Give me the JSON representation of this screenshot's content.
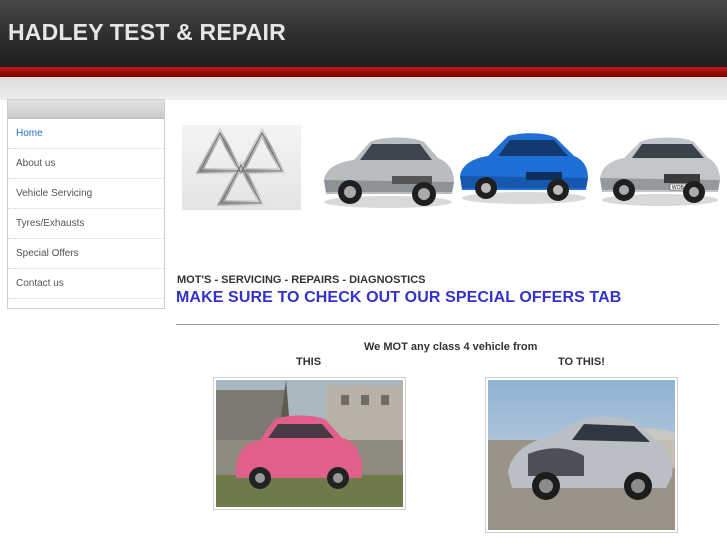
{
  "header": {
    "site_title": "HADLEY TEST & REPAIR"
  },
  "sidebar": {
    "items": [
      {
        "label": "Home",
        "active": true
      },
      {
        "label": "About us",
        "active": false
      },
      {
        "label": "Vehicle Servicing",
        "active": false
      },
      {
        "label": "Tyres/Exhausts",
        "active": false
      },
      {
        "label": "Special Offers",
        "active": false
      },
      {
        "label": "Contact us",
        "active": false
      }
    ]
  },
  "main": {
    "tagline": "MOT'S - SERVICING - REPAIRS - DIAGNOSTICS",
    "offers_heading": "MAKE SURE TO CHECK OUT OUR SPECIAL OFFERS TAB",
    "mot_line": "We MOT any class 4 vehicle from",
    "label_this": "THIS",
    "label_tothis": "TO THIS!"
  },
  "banner": {
    "number_plate": "WOB Y 688"
  },
  "colors": {
    "header_bg": "#2e2e2e",
    "accent_red": "#b01010",
    "nav_active": "#2a6fc0",
    "offers_heading": "#3333cc"
  },
  "icons": [
    "triangle-logo-icon"
  ]
}
